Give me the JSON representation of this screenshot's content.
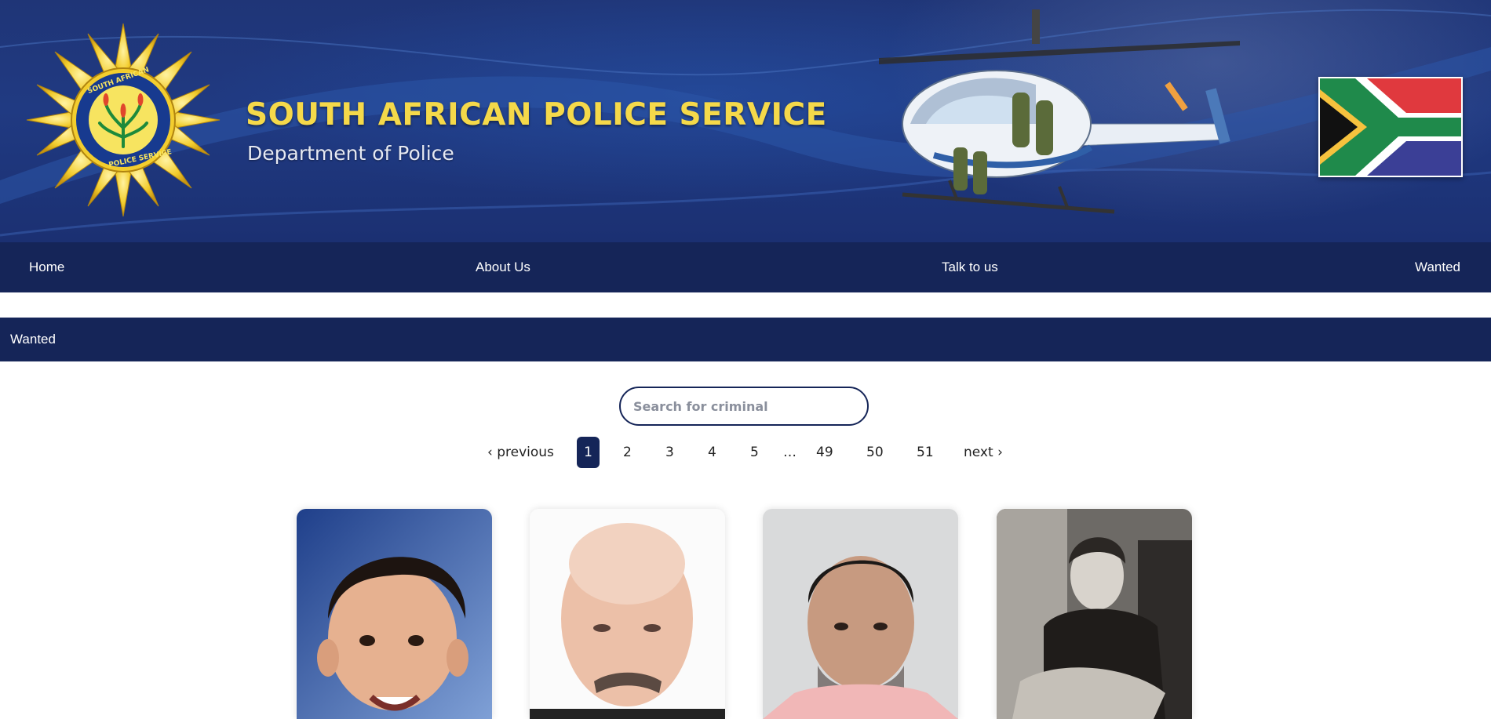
{
  "banner": {
    "title": "SOUTH AFRICAN POLICE SERVICE",
    "subtitle": "Department of Police"
  },
  "nav": {
    "items": [
      {
        "label": "Home"
      },
      {
        "label": "About Us"
      },
      {
        "label": "Talk to us"
      },
      {
        "label": "Wanted"
      }
    ]
  },
  "section": {
    "title": "Wanted"
  },
  "search": {
    "placeholder": "Search for criminal",
    "value": ""
  },
  "pagination": {
    "previous_label": "‹ previous",
    "next_label": "next ›",
    "current_page": "1",
    "pages": [
      "1",
      "2",
      "3",
      "4",
      "5",
      "…",
      "49",
      "50",
      "51"
    ]
  },
  "colors": {
    "nav_background": "#152558",
    "title_gold": "#f5d94a",
    "active_page": "#152558"
  }
}
